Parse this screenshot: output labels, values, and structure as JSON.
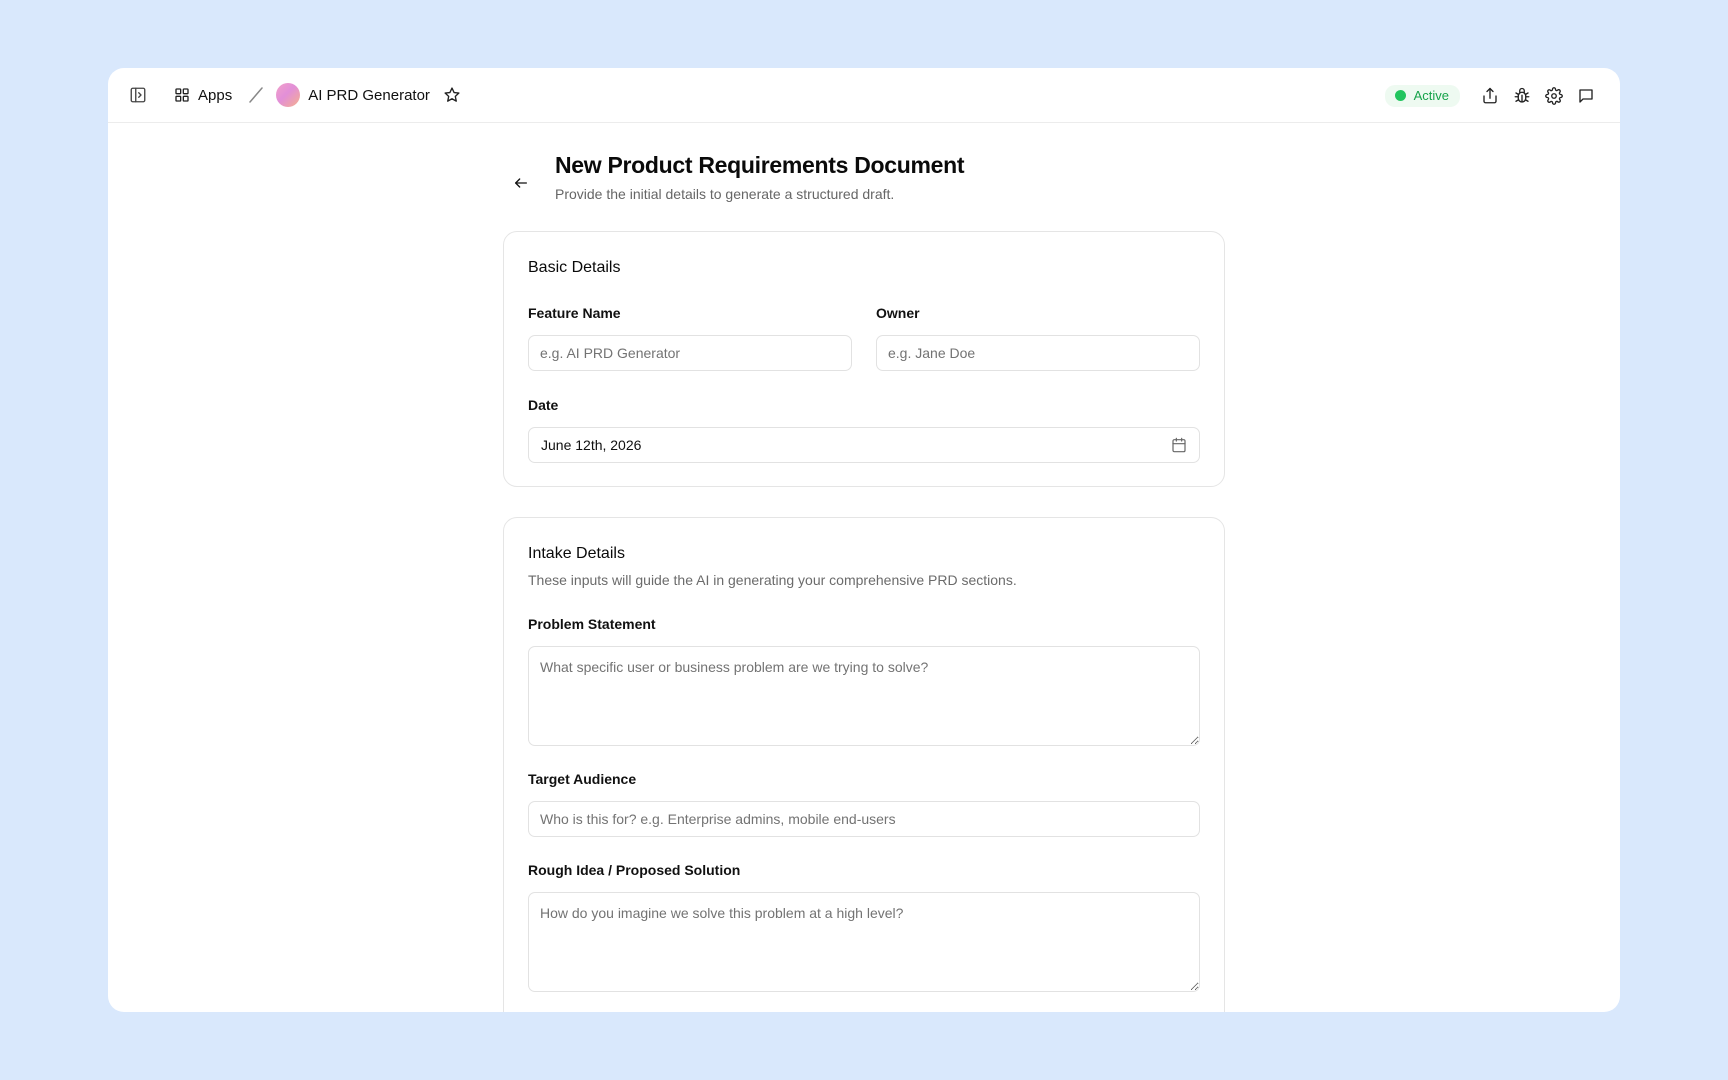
{
  "topbar": {
    "apps_label": "Apps",
    "app_name": "AI PRD Generator",
    "status": "Active",
    "colors": {
      "status_text": "#16a34a",
      "status_dot": "#22c55e",
      "status_bg": "#eefaf1"
    }
  },
  "page": {
    "title": "New Product Requirements Document",
    "subtitle": "Provide the initial details to generate a structured draft."
  },
  "basic_details": {
    "title": "Basic Details",
    "feature_name": {
      "label": "Feature Name",
      "placeholder": "e.g. AI PRD Generator",
      "value": ""
    },
    "owner": {
      "label": "Owner",
      "placeholder": "e.g. Jane Doe",
      "value": ""
    },
    "date": {
      "label": "Date",
      "value": "June 12th, 2026"
    }
  },
  "intake_details": {
    "title": "Intake Details",
    "description": "These inputs will guide the AI in generating your comprehensive PRD sections.",
    "problem_statement": {
      "label": "Problem Statement",
      "placeholder": "What specific user or business problem are we trying to solve?",
      "value": ""
    },
    "target_audience": {
      "label": "Target Audience",
      "placeholder": "Who is this for? e.g. Enterprise admins, mobile end-users",
      "value": ""
    },
    "rough_idea": {
      "label": "Rough Idea / Proposed Solution",
      "placeholder": "How do you imagine we solve this problem at a high level?",
      "value": ""
    }
  }
}
